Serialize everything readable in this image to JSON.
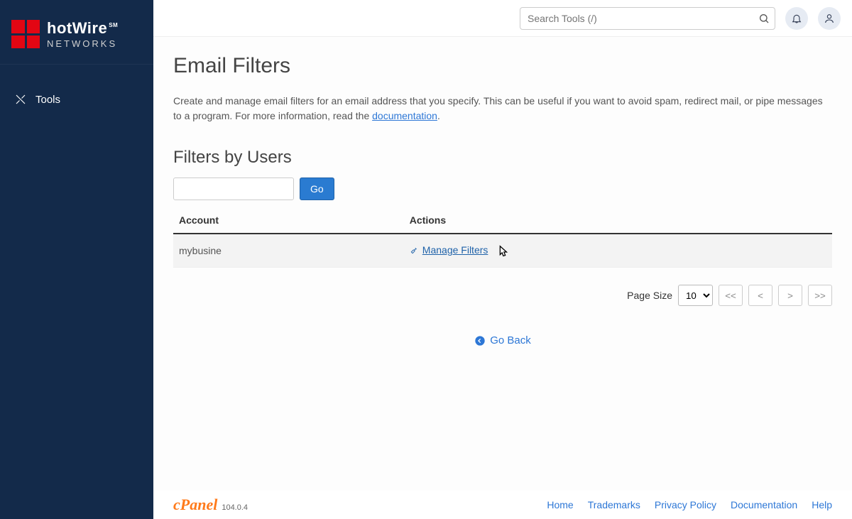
{
  "brand": {
    "name": "hotWire",
    "sm": "SM",
    "network_label": "NETWORKS"
  },
  "sidebar": {
    "items": [
      {
        "label": "Tools"
      }
    ]
  },
  "search": {
    "placeholder": "Search Tools (/)"
  },
  "page": {
    "title": "Email Filters",
    "desc_pre": "Create and manage email filters for an email address that you specify. This can be useful if you want to avoid spam, redirect mail, or pipe messages to a program. For more information, read the ",
    "desc_link": "documentation",
    "desc_post": "."
  },
  "section": {
    "title": "Filters by Users",
    "go_label": "Go",
    "columns": {
      "account": "Account",
      "actions": "Actions"
    },
    "rows": [
      {
        "account": "mybusine",
        "action_label": "Manage Filters"
      }
    ]
  },
  "pager": {
    "size_label": "Page Size",
    "size_value": "10",
    "first": "<<",
    "prev": "<",
    "next": ">",
    "last": ">>"
  },
  "go_back": "Go Back",
  "footer": {
    "app": "cPanel",
    "version": "104.0.4",
    "links": [
      "Home",
      "Trademarks",
      "Privacy Policy",
      "Documentation",
      "Help"
    ]
  }
}
